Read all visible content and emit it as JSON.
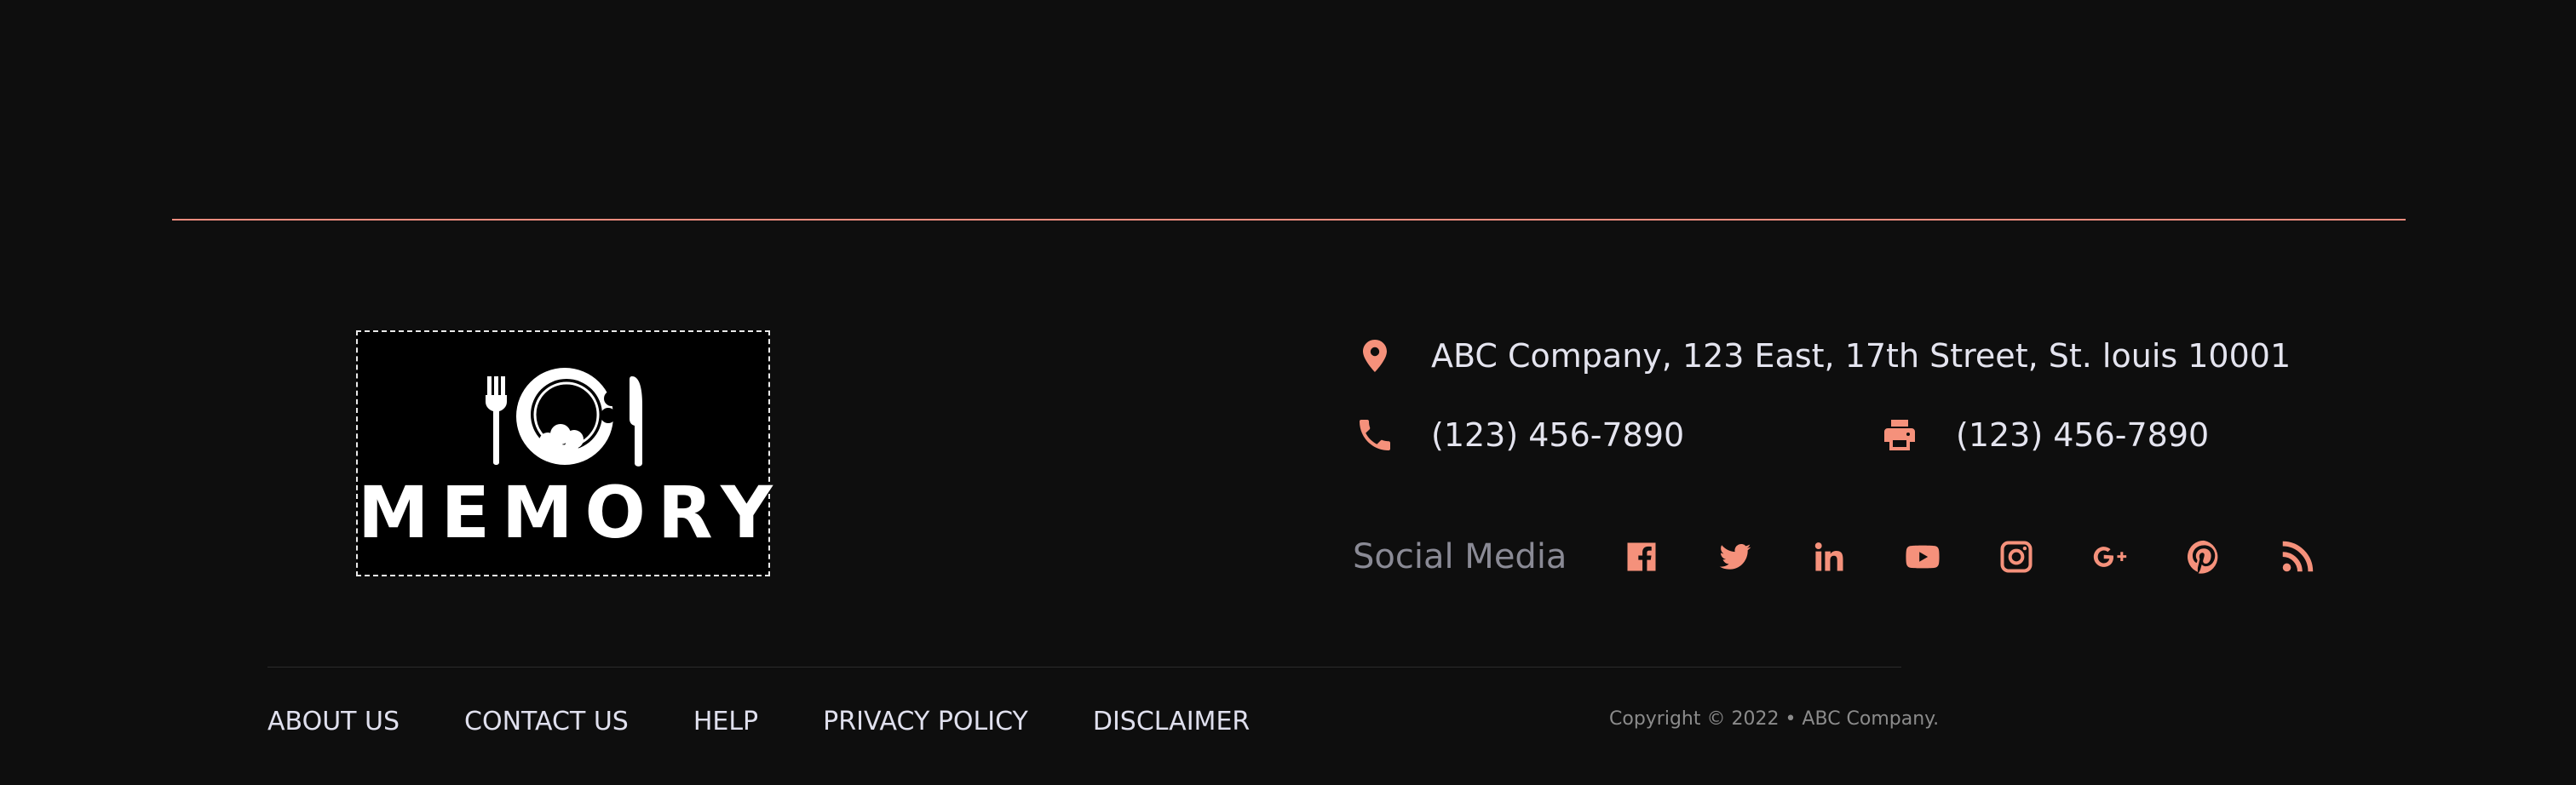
{
  "accent_color": "#f5917b",
  "brand": {
    "logo_text": "MEMORY"
  },
  "contact": {
    "address": {
      "icon": "map-pin-icon",
      "text": "ABC Company, 123 East, 17th Street, St. louis 10001"
    },
    "phone": {
      "icon": "phone-icon",
      "text": "(123) 456-7890"
    },
    "fax": {
      "icon": "printer-icon",
      "text": "(123) 456-7890"
    }
  },
  "social": {
    "label": "Social Media",
    "icons": [
      "facebook-icon",
      "twitter-icon",
      "linkedin-icon",
      "youtube-icon",
      "instagram-icon",
      "google-plus-icon",
      "pinterest-icon",
      "rss-icon"
    ]
  },
  "footer_nav": {
    "items": [
      {
        "label": "ABOUT US"
      },
      {
        "label": "CONTACT US"
      },
      {
        "label": "HELP"
      },
      {
        "label": "PRIVACY POLICY"
      },
      {
        "label": "DISCLAIMER"
      }
    ]
  },
  "copyright": "Copyright © 2022 • ABC Company."
}
